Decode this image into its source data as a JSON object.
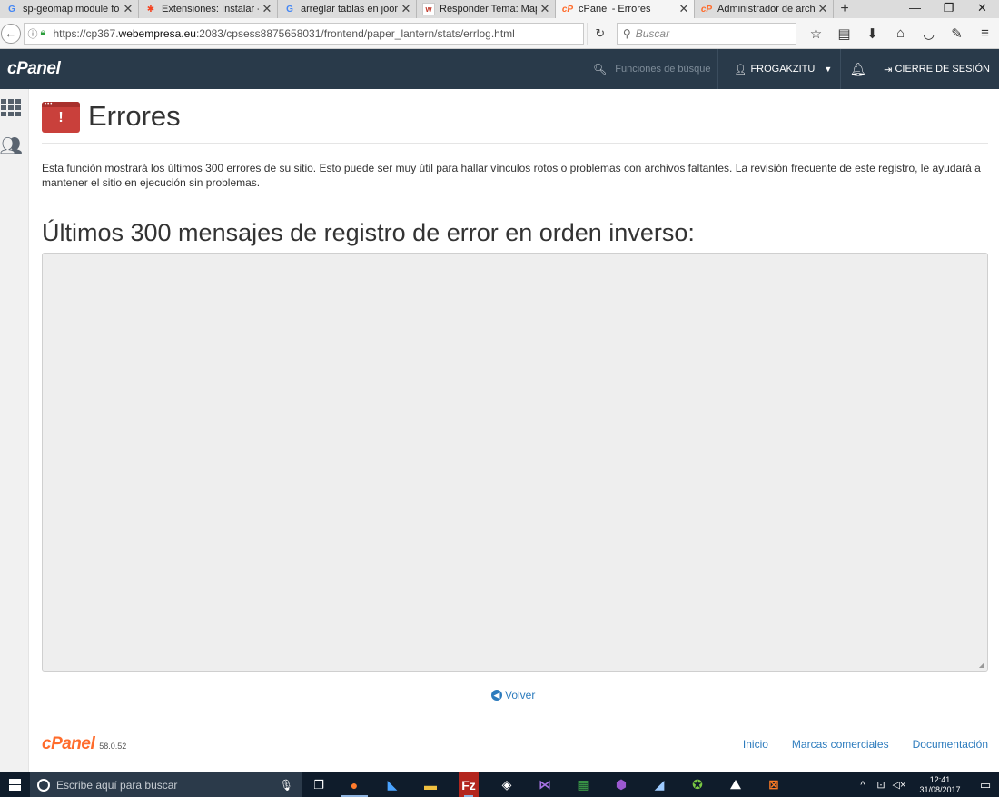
{
  "browser": {
    "tabs": [
      {
        "title": "sp-geomap module fo",
        "favicon": "google-icon",
        "active": false
      },
      {
        "title": "Extensiones: Instalar - ",
        "favicon": "joomla-icon",
        "active": false
      },
      {
        "title": "arreglar tablas en joom",
        "favicon": "google-icon",
        "active": false
      },
      {
        "title": "Responder Tema: Map",
        "favicon": "w-icon",
        "active": false
      },
      {
        "title": "cPanel - Errores",
        "favicon": "cpanel-icon",
        "active": true
      },
      {
        "title": "Administrador de arch",
        "favicon": "cpanel-icon",
        "active": false
      }
    ],
    "url_prefix": "https://cp367.",
    "url_domain": "webempresa.eu",
    "url_rest": ":2083/cpsess8875658031/frontend/paper_lantern/stats/errlog.html",
    "search_placeholder": "Buscar"
  },
  "header": {
    "logo": "cPanel",
    "search_placeholder": "Funciones de búsque",
    "username": "FROGAKZITU",
    "logout_label": "CIERRE DE SESIÓN",
    "bg_color": "#293a4a"
  },
  "page": {
    "title": "Errores",
    "description": "Esta función mostrará los últimos 300 errores de su sitio. Esto puede ser muy útil para hallar vínculos rotos o problemas con archivos faltantes. La revisión frecuente de este registro, le ayudará a mantener el sitio en ejecución sin problemas.",
    "subtitle": "Últimos 300 mensajes de registro de error en orden inverso:",
    "log_content": "",
    "back_label": "Volver"
  },
  "footer": {
    "logo": "cPanel",
    "version": "58.0.52",
    "links": [
      "Inicio",
      "Marcas comerciales",
      "Documentación"
    ],
    "accent_color": "#ff6c2c"
  },
  "taskbar": {
    "search_placeholder": "Escribe aquí para buscar",
    "time": "12:41",
    "date": "31/08/2017"
  }
}
